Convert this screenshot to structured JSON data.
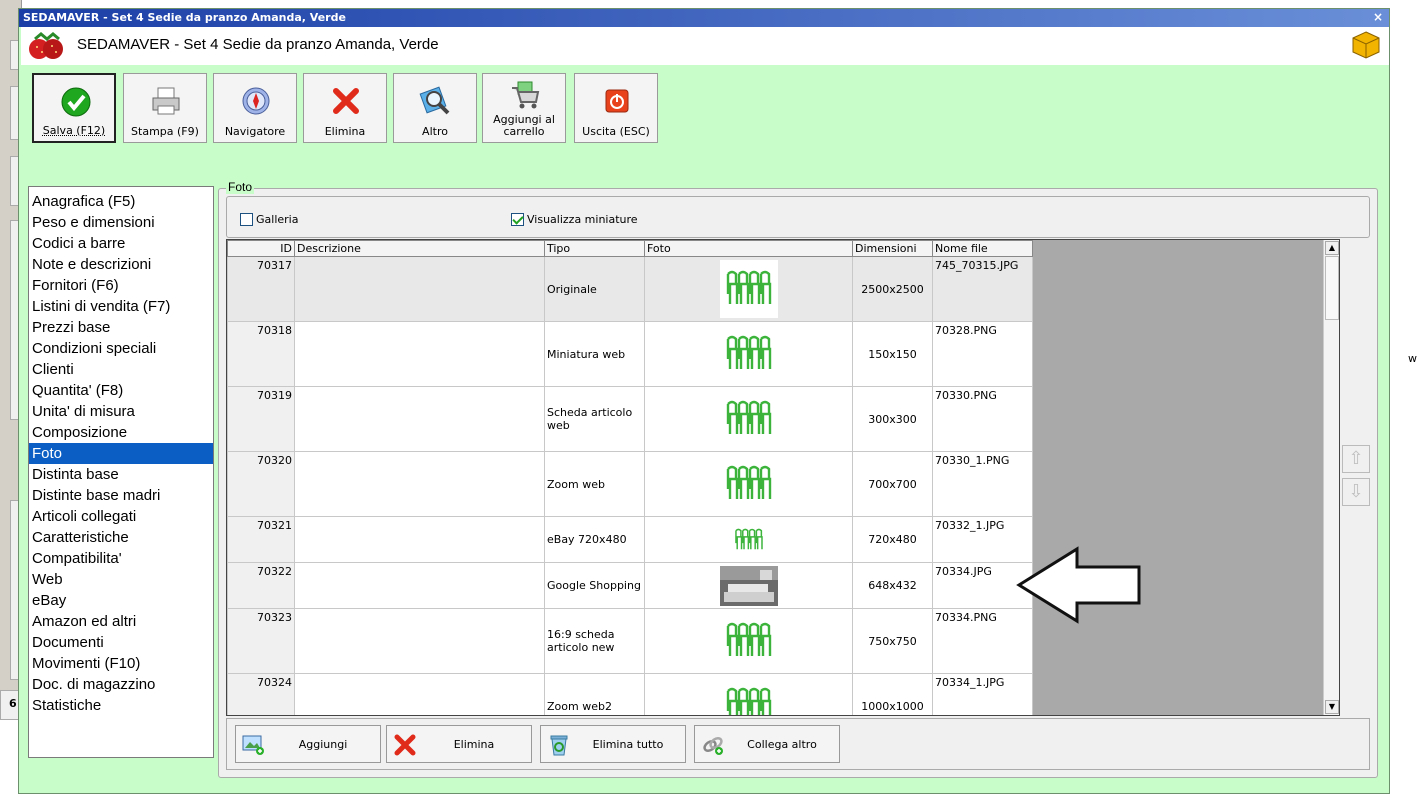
{
  "window": {
    "title": "SEDAMAVER - Set 4 Sedie da pranzo Amanda, Verde",
    "header_title": "SEDAMAVER - Set 4 Sedie da pranzo Amanda, Verde",
    "close_label": "×"
  },
  "toolbar": [
    {
      "label": "Salva (F12)",
      "icon": "check-icon"
    },
    {
      "label": "Stampa (F9)",
      "icon": "printer-icon"
    },
    {
      "label": "Navigatore",
      "icon": "compass-icon"
    },
    {
      "label": "Elimina",
      "icon": "red-x-icon"
    },
    {
      "label": "Altro",
      "icon": "magnifier-icon"
    },
    {
      "label": "Aggiungi al carrello",
      "icon": "cart-icon"
    },
    {
      "label": "Uscita (ESC)",
      "icon": "power-icon"
    }
  ],
  "menu": {
    "items": [
      "Anagrafica (F5)",
      "Peso e dimensioni",
      "Codici a barre",
      "Note e descrizioni",
      "Fornitori (F6)",
      "Listini di vendita (F7)",
      "Prezzi base",
      "Condizioni speciali",
      "Clienti",
      "Quantita' (F8)",
      "Unita' di misura",
      "Composizione",
      "Foto",
      "Distinta base",
      "Distinte base madri",
      "Articoli collegati",
      "Caratteristiche",
      "Compatibilita'",
      "Web",
      "eBay",
      "Amazon ed altri",
      "Documenti",
      "Movimenti (F10)",
      "Doc. di magazzino",
      "Statistiche"
    ],
    "selected": "Foto"
  },
  "foto": {
    "group_label": "Foto",
    "galleria_label": "Galleria",
    "galleria_checked": false,
    "miniature_label": "Visualizza miniature",
    "miniature_checked": true
  },
  "grid": {
    "columns": [
      "ID",
      "Descrizione",
      "Tipo",
      "Foto",
      "Dimensioni",
      "Nome file"
    ],
    "rows": [
      {
        "id": "70317",
        "desc": "",
        "tipo": "Originale",
        "dim": "2500x2500",
        "file": "745_70315.JPG",
        "photo": "chairs"
      },
      {
        "id": "70318",
        "desc": "",
        "tipo": "Miniatura web",
        "dim": "150x150",
        "file": "70328.PNG",
        "photo": "chairs"
      },
      {
        "id": "70319",
        "desc": "",
        "tipo": "Scheda articolo web",
        "dim": "300x300",
        "file": "70330.PNG",
        "photo": "chairs"
      },
      {
        "id": "70320",
        "desc": "",
        "tipo": "Zoom web",
        "dim": "700x700",
        "file": "70330_1.PNG",
        "photo": "chairs"
      },
      {
        "id": "70321",
        "desc": "",
        "tipo": "eBay 720x480",
        "dim": "720x480",
        "file": "70332_1.JPG",
        "photo": "chairs-small"
      },
      {
        "id": "70322",
        "desc": "",
        "tipo": "Google Shopping",
        "dim": "648x432",
        "file": "70334.JPG",
        "photo": "room"
      },
      {
        "id": "70323",
        "desc": "",
        "tipo": "16:9 scheda articolo new",
        "dim": "750x750",
        "file": "70334.PNG",
        "photo": "chairs"
      },
      {
        "id": "70324",
        "desc": "",
        "tipo": "Zoom web2",
        "dim": "1000x1000",
        "file": "70334_1.JPG",
        "photo": "chairs"
      }
    ]
  },
  "bottom_buttons": [
    {
      "label": "Aggiungi",
      "icon": "add-image-icon"
    },
    {
      "label": "Elimina",
      "icon": "red-x-icon"
    },
    {
      "label": "Elimina tutto",
      "icon": "recycle-icon"
    },
    {
      "label": "Collega altro",
      "icon": "link-icon"
    }
  ],
  "background": {
    "right_letter": "w",
    "bottom_digit": "6"
  },
  "colors": {
    "window_bg": "#c8fcc8",
    "selection": "#0b5fc4",
    "titlebar": "#1a3ea6"
  }
}
